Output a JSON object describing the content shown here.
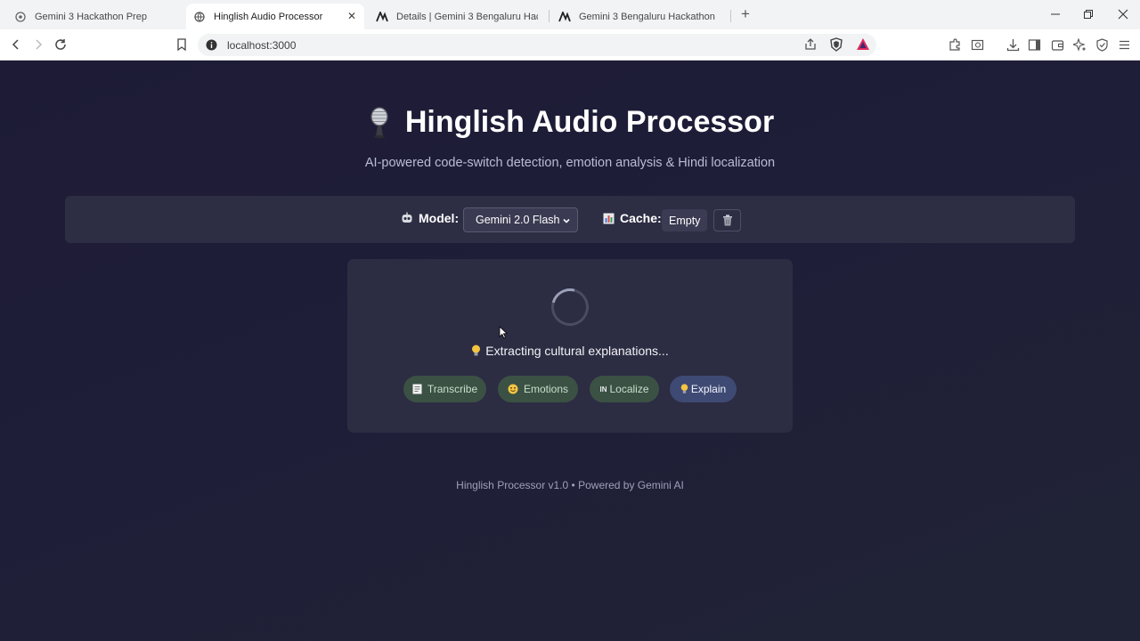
{
  "browser": {
    "tabs": [
      {
        "title": "Gemini 3 Hackathon Prep",
        "icon": "globe-icon"
      },
      {
        "title": "Hinglish Audio Processor",
        "icon": "globe-icon",
        "active": true
      },
      {
        "title": "Details | Gemini 3 Bengaluru Hackathon",
        "icon": "devpost-icon"
      },
      {
        "title": "Gemini 3 Bengaluru Hackathon",
        "icon": "devpost-icon"
      }
    ],
    "url": "localhost:3000"
  },
  "header": {
    "title": "Hinglish Audio Processor",
    "subtitle": "AI-powered code-switch detection, emotion analysis & Hindi localization"
  },
  "controls": {
    "model_label": "Model:",
    "model_value": "Gemini 2.0 Flash",
    "cache_label": "Cache:",
    "cache_value": "Empty"
  },
  "processing": {
    "status": "Extracting cultural explanations...",
    "steps": [
      {
        "label": "Transcribe",
        "state": "done",
        "icon": "memo-icon"
      },
      {
        "label": "Emotions",
        "state": "done",
        "icon": "smiley-icon"
      },
      {
        "label": "Localize",
        "state": "done",
        "icon": "in-letters-icon"
      },
      {
        "label": "Explain",
        "state": "active",
        "icon": "lightbulb-icon"
      }
    ]
  },
  "footer": {
    "text": "Hinglish Processor v1.0 • Powered by Gemini AI"
  },
  "colors": {
    "page_bg": "#1c1b33",
    "panel_bg": "#2d2d44",
    "step_done": "#3b5144",
    "step_active": "#3e4a73"
  }
}
